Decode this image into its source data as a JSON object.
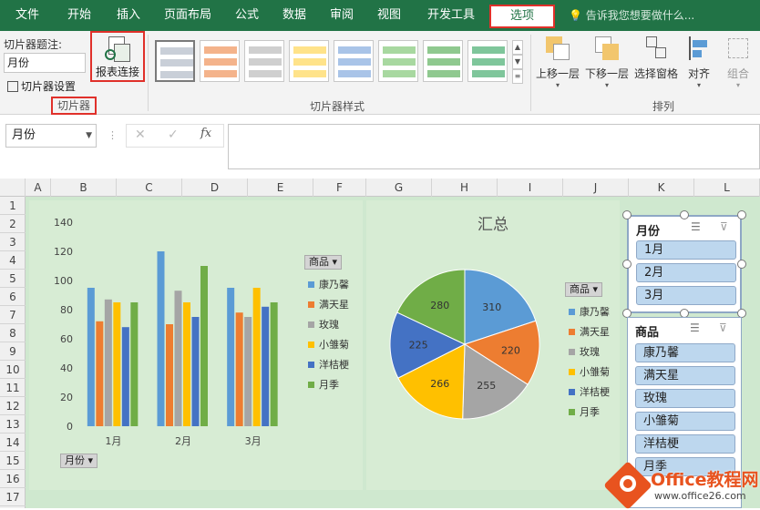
{
  "menu": {
    "items": [
      "文件",
      "开始",
      "插入",
      "页面布局",
      "公式",
      "数据",
      "审阅",
      "视图",
      "开发工具",
      "选项"
    ],
    "tell_me": "告诉我您想要做什么..."
  },
  "ribbon": {
    "caption_label": "切片器题注:",
    "caption_value": "月份",
    "settings_label": "切片器设置",
    "report_conn_label": "报表连接",
    "group_slicer": "切片器",
    "group_styles": "切片器样式",
    "group_arrange": "排列",
    "bring_forward": "上移一层",
    "send_backward": "下移一层",
    "selection_pane": "选择窗格",
    "align": "对齐",
    "group": "组合"
  },
  "formula": {
    "namebox": "月份",
    "cancel": "✕",
    "enter": "✓",
    "fx": "fx"
  },
  "columns": [
    "A",
    "B",
    "C",
    "D",
    "E",
    "F",
    "G",
    "H",
    "I",
    "J",
    "K",
    "L"
  ],
  "rows": [
    "1",
    "2",
    "3",
    "4",
    "5",
    "6",
    "7",
    "8",
    "9",
    "10",
    "11",
    "12",
    "13",
    "14",
    "15",
    "16",
    "17"
  ],
  "bar_chart": {
    "legend_title": "商品",
    "filter_label": "月份",
    "chart_data": {
      "type": "bar",
      "categories": [
        "1月",
        "2月",
        "3月"
      ],
      "series": [
        {
          "name": "康乃馨",
          "values": [
            95,
            120,
            95
          ],
          "color": "#5b9bd5"
        },
        {
          "name": "满天星",
          "values": [
            72,
            70,
            78
          ],
          "color": "#ed7d31"
        },
        {
          "name": "玫瑰",
          "values": [
            87,
            93,
            75
          ],
          "color": "#a5a5a5"
        },
        {
          "name": "小雏菊",
          "values": [
            85,
            85,
            95
          ],
          "color": "#ffc000"
        },
        {
          "name": "洋桔梗",
          "values": [
            68,
            75,
            82
          ],
          "color": "#4472c4"
        },
        {
          "name": "月季",
          "values": [
            85,
            110,
            85
          ],
          "color": "#70ad47"
        }
      ],
      "ylim": [
        0,
        140
      ],
      "yticks": [
        0,
        20,
        40,
        60,
        80,
        100,
        120,
        140
      ]
    }
  },
  "pie_chart": {
    "legend_title": "商品",
    "chart_data": {
      "type": "pie",
      "title": "汇总",
      "labels": [
        "康乃馨",
        "满天星",
        "玫瑰",
        "小雏菊",
        "洋桔梗",
        "月季"
      ],
      "values": [
        310,
        220,
        255,
        266,
        225,
        280
      ],
      "colors": [
        "#5b9bd5",
        "#ed7d31",
        "#a5a5a5",
        "#ffc000",
        "#4472c4",
        "#70ad47"
      ]
    }
  },
  "slicer_month": {
    "title": "月份",
    "items": [
      "1月",
      "2月",
      "3月"
    ]
  },
  "slicer_product": {
    "title": "商品",
    "items": [
      "康乃馨",
      "满天星",
      "玫瑰",
      "小雏菊",
      "洋桔梗",
      "月季"
    ]
  },
  "logo": {
    "brand": "Office教程网",
    "url": "www.office26.com"
  }
}
